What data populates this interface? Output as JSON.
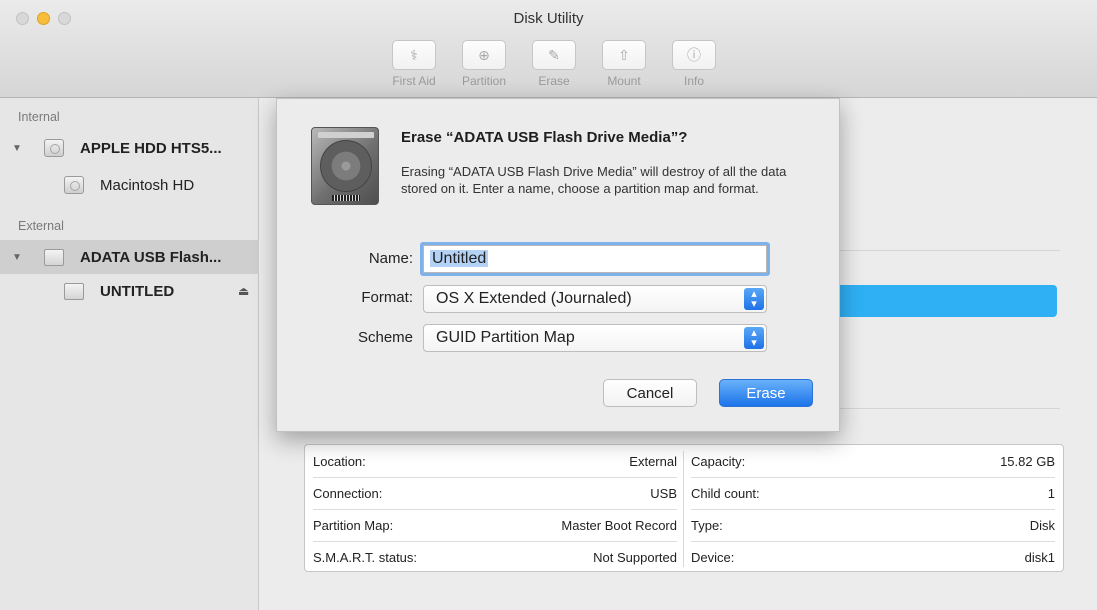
{
  "window": {
    "title": "Disk Utility"
  },
  "toolbar": {
    "items": [
      {
        "label": "First Aid",
        "icon": "stethoscope-icon",
        "glyph": "⚕"
      },
      {
        "label": "Partition",
        "icon": "partition-icon",
        "glyph": "⊕"
      },
      {
        "label": "Erase",
        "icon": "erase-icon",
        "glyph": "✎"
      },
      {
        "label": "Mount",
        "icon": "mount-icon",
        "glyph": "⇧"
      },
      {
        "label": "Info",
        "icon": "info-icon",
        "glyph": "ⓘ"
      }
    ]
  },
  "sidebar": {
    "internal_heading": "Internal",
    "external_heading": "External",
    "internal_disk": "APPLE HDD HTS5...",
    "internal_volume": "Macintosh HD",
    "external_disk": "ADATA USB Flash...",
    "external_volume": "UNTITLED",
    "eject_glyph": "⏏"
  },
  "dialog": {
    "title": "Erase “ADATA USB Flash Drive Media”?",
    "message": "Erasing “ADATA USB Flash Drive Media” will destroy of all the data stored on it. Enter a name, choose a partition map and format.",
    "name_label": "Name:",
    "name_value": "Untitled",
    "format_label": "Format:",
    "format_value": "OS X Extended (Journaled)",
    "scheme_label": "Scheme",
    "scheme_value": "GUID Partition Map",
    "cancel_label": "Cancel",
    "erase_label": "Erase"
  },
  "info": {
    "left": [
      {
        "key": "Location:",
        "value": "External"
      },
      {
        "key": "Connection:",
        "value": "USB"
      },
      {
        "key": "Partition Map:",
        "value": "Master Boot Record"
      },
      {
        "key": "S.M.A.R.T. status:",
        "value": "Not Supported"
      }
    ],
    "right": [
      {
        "key": "Capacity:",
        "value": "15.82 GB"
      },
      {
        "key": "Child count:",
        "value": "1"
      },
      {
        "key": "Type:",
        "value": "Disk"
      },
      {
        "key": "Device:",
        "value": "disk1"
      }
    ]
  },
  "colors": {
    "accent": "#1d74ea",
    "usage_bar": "#2fb0f5",
    "minimize": "#f6be3b"
  }
}
